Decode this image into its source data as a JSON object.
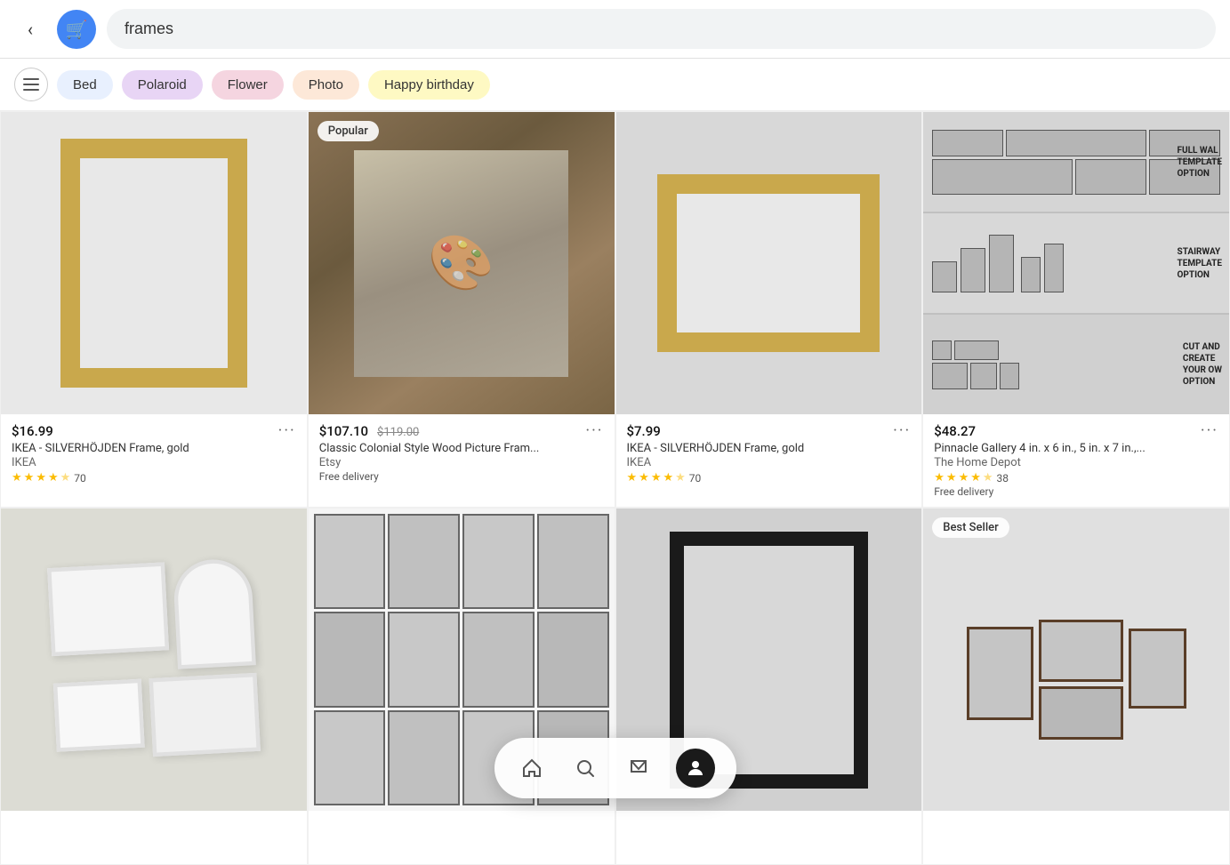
{
  "header": {
    "back_label": "‹",
    "search_icon_label": "🛒",
    "search_value": "frames"
  },
  "chips": [
    {
      "id": "filter",
      "label": "⚙",
      "type": "icon"
    },
    {
      "id": "bed",
      "label": "Bed",
      "class": "chip-bed"
    },
    {
      "id": "polaroid",
      "label": "Polaroid",
      "class": "chip-polaroid"
    },
    {
      "id": "flower",
      "label": "Flower",
      "class": "chip-flower"
    },
    {
      "id": "photo",
      "label": "Photo",
      "class": "chip-photo"
    },
    {
      "id": "birthday",
      "label": "Happy birthday",
      "class": "chip-birthday"
    }
  ],
  "products": [
    {
      "id": "p1",
      "price": "$16.99",
      "price_old": null,
      "name": "IKEA - SILVERHÖJDEN Frame, gold",
      "store": "IKEA",
      "rating": 4.5,
      "reviews": "70",
      "delivery": null,
      "badge": null,
      "type": "gold-portrait"
    },
    {
      "id": "p2",
      "price": "$107.10",
      "price_old": "$119.00",
      "name": "Classic Colonial Style Wood Picture Fram...",
      "store": "Etsy",
      "rating": 0,
      "reviews": null,
      "delivery": "Free delivery",
      "badge": "Popular",
      "type": "ornate"
    },
    {
      "id": "p3",
      "price": "$7.99",
      "price_old": null,
      "name": "IKEA - SILVERHÖJDEN Frame, gold",
      "store": "IKEA",
      "rating": 4.5,
      "reviews": "70",
      "delivery": null,
      "badge": null,
      "type": "gold-landscape"
    },
    {
      "id": "p4",
      "price": "$48.27",
      "price_old": null,
      "name": "Pinnacle Gallery 4 in. x 6 in., 5 in. x 7 in.,...",
      "store": "The Home Depot",
      "rating": 4.5,
      "reviews": "38",
      "delivery": "Free delivery",
      "badge": null,
      "type": "gallery-template"
    },
    {
      "id": "p5",
      "price": null,
      "price_old": null,
      "name": null,
      "store": null,
      "rating": 0,
      "reviews": null,
      "delivery": null,
      "badge": null,
      "type": "white-frames"
    },
    {
      "id": "p6",
      "price": null,
      "price_old": null,
      "name": null,
      "store": null,
      "rating": 0,
      "reviews": null,
      "delivery": null,
      "badge": null,
      "type": "gallery-wall"
    },
    {
      "id": "p7",
      "price": null,
      "price_old": null,
      "name": null,
      "store": null,
      "rating": 0,
      "reviews": null,
      "delivery": null,
      "badge": null,
      "type": "black-frame"
    },
    {
      "id": "p8",
      "price": null,
      "price_old": null,
      "name": null,
      "store": null,
      "rating": 0,
      "reviews": null,
      "delivery": null,
      "badge": "Best Seller",
      "type": "bottom-gallery"
    }
  ],
  "panel_labels": {
    "full_wall": "FULL WAL\nTEMPLATE\nOPTION",
    "stairway": "STAIRWAY\nTEMPLATE\nOPTION",
    "cut_create": "CUT AND\nCREATE\nYOUR OW\nOPTION"
  },
  "bottom_nav": {
    "home_icon": "🏠",
    "search_icon": "🔍",
    "message_icon": "💬",
    "profile_icon": "●"
  }
}
